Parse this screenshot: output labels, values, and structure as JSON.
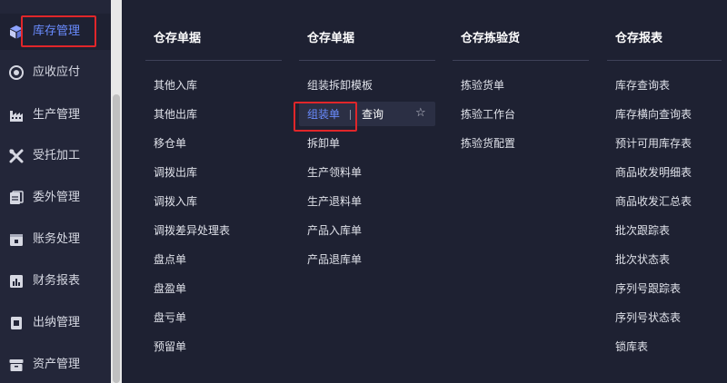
{
  "sidebar": {
    "items": [
      {
        "label": "库存管理",
        "icon": "cube-icon"
      },
      {
        "label": "应收应付",
        "icon": "money-icon"
      },
      {
        "label": "生产管理",
        "icon": "factory-icon"
      },
      {
        "label": "受托加工",
        "icon": "tools-icon"
      },
      {
        "label": "委外管理",
        "icon": "books-icon"
      },
      {
        "label": "账务处理",
        "icon": "ledger-icon"
      },
      {
        "label": "财务报表",
        "icon": "report-icon"
      },
      {
        "label": "出纳管理",
        "icon": "cashier-icon"
      },
      {
        "label": "资产管理",
        "icon": "asset-icon"
      }
    ]
  },
  "menu": {
    "columns": [
      {
        "title": "仓存单据",
        "items": [
          "其他入库",
          "其他出库",
          "移仓单",
          "调拨出库",
          "调拨入库",
          "调拨差异处理表",
          "盘点单",
          "盘盈单",
          "盘亏单",
          "预留单"
        ]
      },
      {
        "title": "仓存单据",
        "items": [
          "组装拆卸模板",
          "组装单",
          "拆卸单",
          "生产领料单",
          "生产退料单",
          "产品入库单",
          "产品退库单"
        ]
      },
      {
        "title": "仓存拣验货",
        "items": [
          "拣验货单",
          "拣验工作台",
          "拣验货配置"
        ]
      },
      {
        "title": "仓存报表",
        "items": [
          "库存查询表",
          "库存横向查询表",
          "预计可用库存表",
          "商品收发明细表",
          "商品收发汇总表",
          "批次跟踪表",
          "批次状态表",
          "序列号跟踪表",
          "序列号状态表",
          "锁库表"
        ]
      }
    ],
    "hover_action": "查询"
  },
  "colors": {
    "background": "#1e2132",
    "sidebar": "#232639",
    "accent": "#6a8cff",
    "highlight_box": "#e0262a"
  }
}
